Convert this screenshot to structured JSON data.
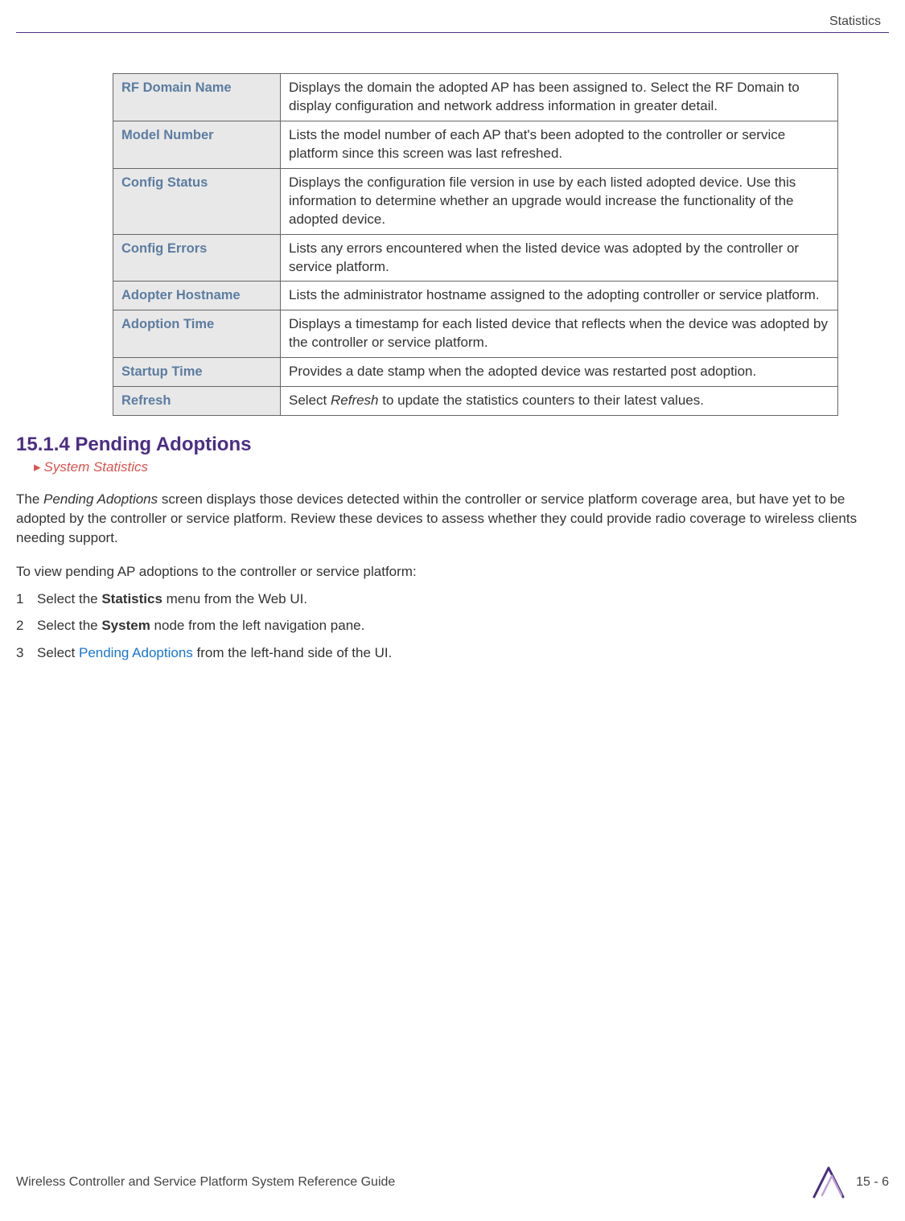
{
  "header": {
    "chapter": "Statistics"
  },
  "table": {
    "rows": [
      {
        "term": "RF Domain Name",
        "desc": "Displays the domain the adopted AP has been assigned to. Select the RF Domain to display configuration and network address information in greater detail."
      },
      {
        "term": "Model Number",
        "desc": "Lists the model number of each AP that's been adopted to the controller or service platform since this screen was last refreshed."
      },
      {
        "term": "Config Status",
        "desc": "Displays the configuration file version in use by each listed adopted device. Use this information to determine whether an upgrade would increase the functionality of the adopted device."
      },
      {
        "term": "Config Errors",
        "desc": "Lists any errors encountered when the listed device was adopted by the controller or service platform."
      },
      {
        "term": "Adopter Hostname",
        "desc": "Lists the administrator hostname assigned to the adopting controller or service platform."
      },
      {
        "term": "Adoption Time",
        "desc": "Displays a timestamp for each listed device that reflects when the device was adopted by the controller or service platform."
      },
      {
        "term": "Startup Time",
        "desc": "Provides a date stamp when the adopted device was restarted post adoption."
      },
      {
        "term": "Refresh",
        "desc_prefix": "Select ",
        "desc_italic": "Refresh",
        "desc_suffix": " to update the statistics counters to their latest values."
      }
    ]
  },
  "section": {
    "heading": "15.1.4 Pending Adoptions",
    "breadcrumb": "System Statistics",
    "intro_prefix": "The ",
    "intro_italic": "Pending Adoptions",
    "intro_suffix": " screen displays those devices detected within the controller or service platform coverage area, but have yet to be adopted by the controller or service platform. Review these devices to assess whether they could provide radio coverage to wireless clients needing support.",
    "steps_intro": "To view pending AP adoptions to the controller or service platform:",
    "steps": [
      {
        "num": "1",
        "pre": "Select the ",
        "bold": "Statistics",
        "post": " menu from the Web UI."
      },
      {
        "num": "2",
        "pre": "Select the ",
        "bold": "System",
        "post": " node from the left navigation pane."
      },
      {
        "num": "3",
        "pre": "Select ",
        "link": "Pending Adoptions",
        "post": " from the left-hand side of the UI."
      }
    ]
  },
  "footer": {
    "title": "Wireless Controller and Service Platform System Reference Guide",
    "page": "15 - 6"
  }
}
